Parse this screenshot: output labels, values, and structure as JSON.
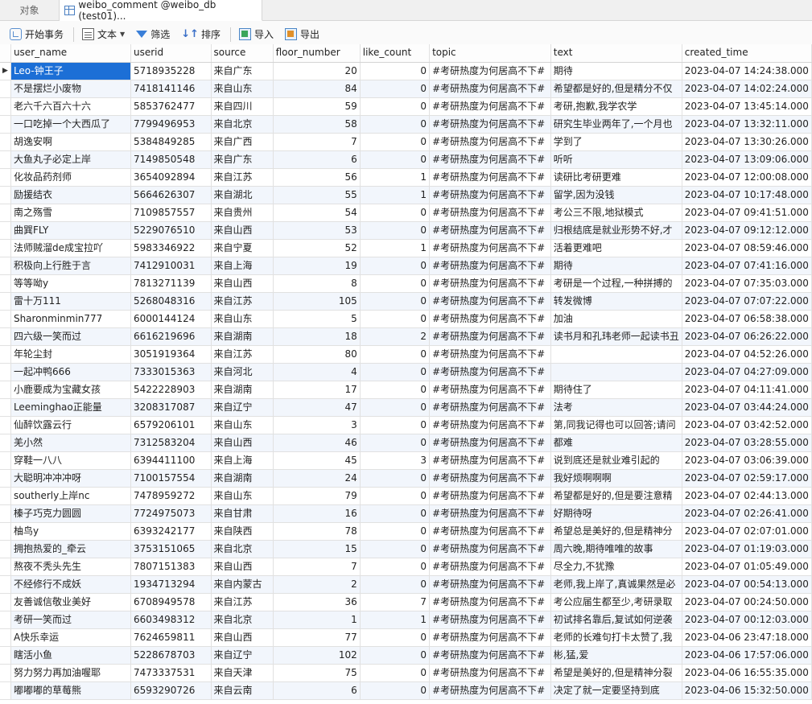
{
  "tabs": [
    {
      "label": "对象",
      "active": false
    },
    {
      "label": "weibo_comment @weibo_db (test01)...",
      "active": true
    }
  ],
  "toolbar": {
    "begin_tx": "开始事务",
    "text": "文本",
    "filter": "筛选",
    "sort": "排序",
    "import": "导入",
    "export": "导出"
  },
  "columns": [
    "user_name",
    "userid",
    "source",
    "floor_number",
    "like_count",
    "topic",
    "text",
    "created_time"
  ],
  "row_indicator": "▶",
  "rows": [
    [
      "Leo-钟王子",
      "5718935228",
      "来自广东",
      "20",
      "0",
      "#考研热度为何居高不下#",
      "期待",
      "2023-04-07 14:24:38.000"
    ],
    [
      "不是摆烂小废物",
      "7418141146",
      "来自山东",
      "84",
      "0",
      "#考研热度为何居高不下#",
      "希望都是好的,但是精分不仅",
      "2023-04-07 14:02:24.000"
    ],
    [
      "老六千六百六十六",
      "5853762477",
      "来自四川",
      "59",
      "0",
      "#考研热度为何居高不下#",
      "考研,抱歉,我学农学",
      "2023-04-07 13:45:14.000"
    ],
    [
      "一口吃掉一个大西瓜了",
      "7799496953",
      "来自北京",
      "58",
      "0",
      "#考研热度为何居高不下#",
      "研究生毕业两年了,一个月也",
      "2023-04-07 13:32:11.000"
    ],
    [
      "胡逸安啊",
      "5384849285",
      "来自广西",
      "7",
      "0",
      "#考研热度为何居高不下#",
      "学到了",
      "2023-04-07 13:30:26.000"
    ],
    [
      "大鱼丸子必定上岸",
      "7149850548",
      "来自广东",
      "6",
      "0",
      "#考研热度为何居高不下#",
      "听听",
      "2023-04-07 13:09:06.000"
    ],
    [
      "化妆品药剂师",
      "3654092894",
      "来自江苏",
      "56",
      "1",
      "#考研热度为何居高不下#",
      "读研比考研更难",
      "2023-04-07 12:00:08.000"
    ],
    [
      "励援结衣",
      "5664626307",
      "来自湖北",
      "55",
      "1",
      "#考研热度为何居高不下#",
      "留学,因为没钱",
      "2023-04-07 10:17:48.000"
    ],
    [
      "南之殇雪",
      "7109857557",
      "来自贵州",
      "54",
      "0",
      "#考研热度为何居高不下#",
      "考公三不限,地狱模式",
      "2023-04-07 09:41:51.000"
    ],
    [
      "曲巽FLY",
      "5229076510",
      "来自山西",
      "53",
      "0",
      "#考研热度为何居高不下#",
      "归根结底是就业形势不好,才",
      "2023-04-07 09:12:12.000"
    ],
    [
      "法师贼溜de成宝拉吖",
      "5983346922",
      "来自宁夏",
      "52",
      "1",
      "#考研热度为何居高不下#",
      "活着更难吧",
      "2023-04-07 08:59:46.000"
    ],
    [
      "积极向上行胜于言",
      "7412910031",
      "来自上海",
      "19",
      "0",
      "#考研热度为何居高不下#",
      "期待",
      "2023-04-07 07:41:16.000"
    ],
    [
      "等等呦y",
      "7813271139",
      "来自山西",
      "8",
      "0",
      "#考研热度为何居高不下#",
      "考研是一个过程,一种拼搏的",
      "2023-04-07 07:35:03.000"
    ],
    [
      "雷十万111",
      "5268048316",
      "来自江苏",
      "105",
      "0",
      "#考研热度为何居高不下#",
      "转发微博",
      "2023-04-07 07:07:22.000"
    ],
    [
      "Sharonminmin777",
      "6000144124",
      "来自山东",
      "5",
      "0",
      "#考研热度为何居高不下#",
      "加油",
      "2023-04-07 06:58:38.000"
    ],
    [
      "四六级一笑而过",
      "6616219696",
      "来自湖南",
      "18",
      "2",
      "#考研热度为何居高不下#",
      "读书月和孔玮老师一起读书丑",
      "2023-04-07 06:26:22.000"
    ],
    [
      "年轮尘封",
      "3051919364",
      "来自江苏",
      "80",
      "0",
      "#考研热度为何居高不下#",
      "",
      "2023-04-07 04:52:26.000"
    ],
    [
      "一起冲鸭666",
      "7333015363",
      "来自河北",
      "4",
      "0",
      "#考研热度为何居高不下#",
      "",
      "2023-04-07 04:27:09.000"
    ],
    [
      "小鹿要成为宝藏女孩",
      "5422228903",
      "来自湖南",
      "17",
      "0",
      "#考研热度为何居高不下#",
      "期待住了",
      "2023-04-07 04:11:41.000"
    ],
    [
      "Leeminghao正能量",
      "3208317087",
      "来自辽宁",
      "47",
      "0",
      "#考研热度为何居高不下#",
      "法考",
      "2023-04-07 03:44:24.000"
    ],
    [
      "仙醉饮露云行",
      "6579206101",
      "来自山东",
      "3",
      "0",
      "#考研热度为何居高不下#",
      "第,同我记得也可以回答;请问",
      "2023-04-07 03:42:52.000"
    ],
    [
      "羌小然",
      "7312583204",
      "来自山西",
      "46",
      "0",
      "#考研热度为何居高不下#",
      "都难",
      "2023-04-07 03:28:55.000"
    ],
    [
      "穿鞋一八八",
      "6394411100",
      "来自上海",
      "45",
      "3",
      "#考研热度为何居高不下#",
      "说到底还是就业难引起的",
      "2023-04-07 03:06:39.000"
    ],
    [
      "大聪明冲冲冲呀",
      "7100157554",
      "来自湖南",
      "24",
      "0",
      "#考研热度为何居高不下#",
      "我好烦啊啊啊",
      "2023-04-07 02:59:17.000"
    ],
    [
      "southerly上岸nc",
      "7478959272",
      "来自山东",
      "79",
      "0",
      "#考研热度为何居高不下#",
      "希望都是好的,但是要注意精",
      "2023-04-07 02:44:13.000"
    ],
    [
      "榛子巧克力圆圆",
      "7724975073",
      "来自甘肃",
      "16",
      "0",
      "#考研热度为何居高不下#",
      "好期待呀",
      "2023-04-07 02:26:41.000"
    ],
    [
      "柚鸟y",
      "6393242177",
      "来自陕西",
      "78",
      "0",
      "#考研热度为何居高不下#",
      "希望总是美好的,但是精神分",
      "2023-04-07 02:07:01.000"
    ],
    [
      "拥抱热爱的_牵云",
      "3753151065",
      "来自北京",
      "15",
      "0",
      "#考研热度为何居高不下#",
      "周六晚,期待唯唯的故事",
      "2023-04-07 01:19:03.000"
    ],
    [
      "熬夜不秃头先生",
      "7807151383",
      "来自山西",
      "7",
      "0",
      "#考研热度为何居高不下#",
      "尽全力,不犹豫",
      "2023-04-07 01:05:49.000"
    ],
    [
      "不经修行不成妖",
      "1934713294",
      "来自内蒙古",
      "2",
      "0",
      "#考研热度为何居高不下#",
      "老师,我上岸了,真诚果然是必",
      "2023-04-07 00:54:13.000"
    ],
    [
      "友善诚信敬业美好",
      "6708949578",
      "来自江苏",
      "36",
      "7",
      "#考研热度为何居高不下#",
      "考公应届生都至少,考研录取",
      "2023-04-07 00:24:50.000"
    ],
    [
      "考研一笑而过",
      "6603498312",
      "来自北京",
      "1",
      "1",
      "#考研热度为何居高不下#",
      "初试排名靠后,复试如何逆袭",
      "2023-04-07 00:12:03.000"
    ],
    [
      "A快乐幸运",
      "7624659811",
      "来自山西",
      "77",
      "0",
      "#考研热度为何居高不下#",
      "老师的长难句打卡太赞了,我",
      "2023-04-06 23:47:18.000"
    ],
    [
      "瞎活小鱼",
      "5228678703",
      "来自辽宁",
      "102",
      "0",
      "#考研热度为何居高不下#",
      "彬,猛,爱",
      "2023-04-06 17:57:06.000"
    ],
    [
      "努力努力再加油喔耶",
      "7473337531",
      "来自天津",
      "75",
      "0",
      "#考研热度为何居高不下#",
      "希望是美好的,但是精神分裂",
      "2023-04-06 16:55:35.000"
    ],
    [
      "嘟嘟嘟的草莓熊",
      "6593290726",
      "来自云南",
      "6",
      "0",
      "#考研热度为何居高不下#",
      "决定了就一定要坚持到底",
      "2023-04-06 15:32:50.000"
    ]
  ]
}
